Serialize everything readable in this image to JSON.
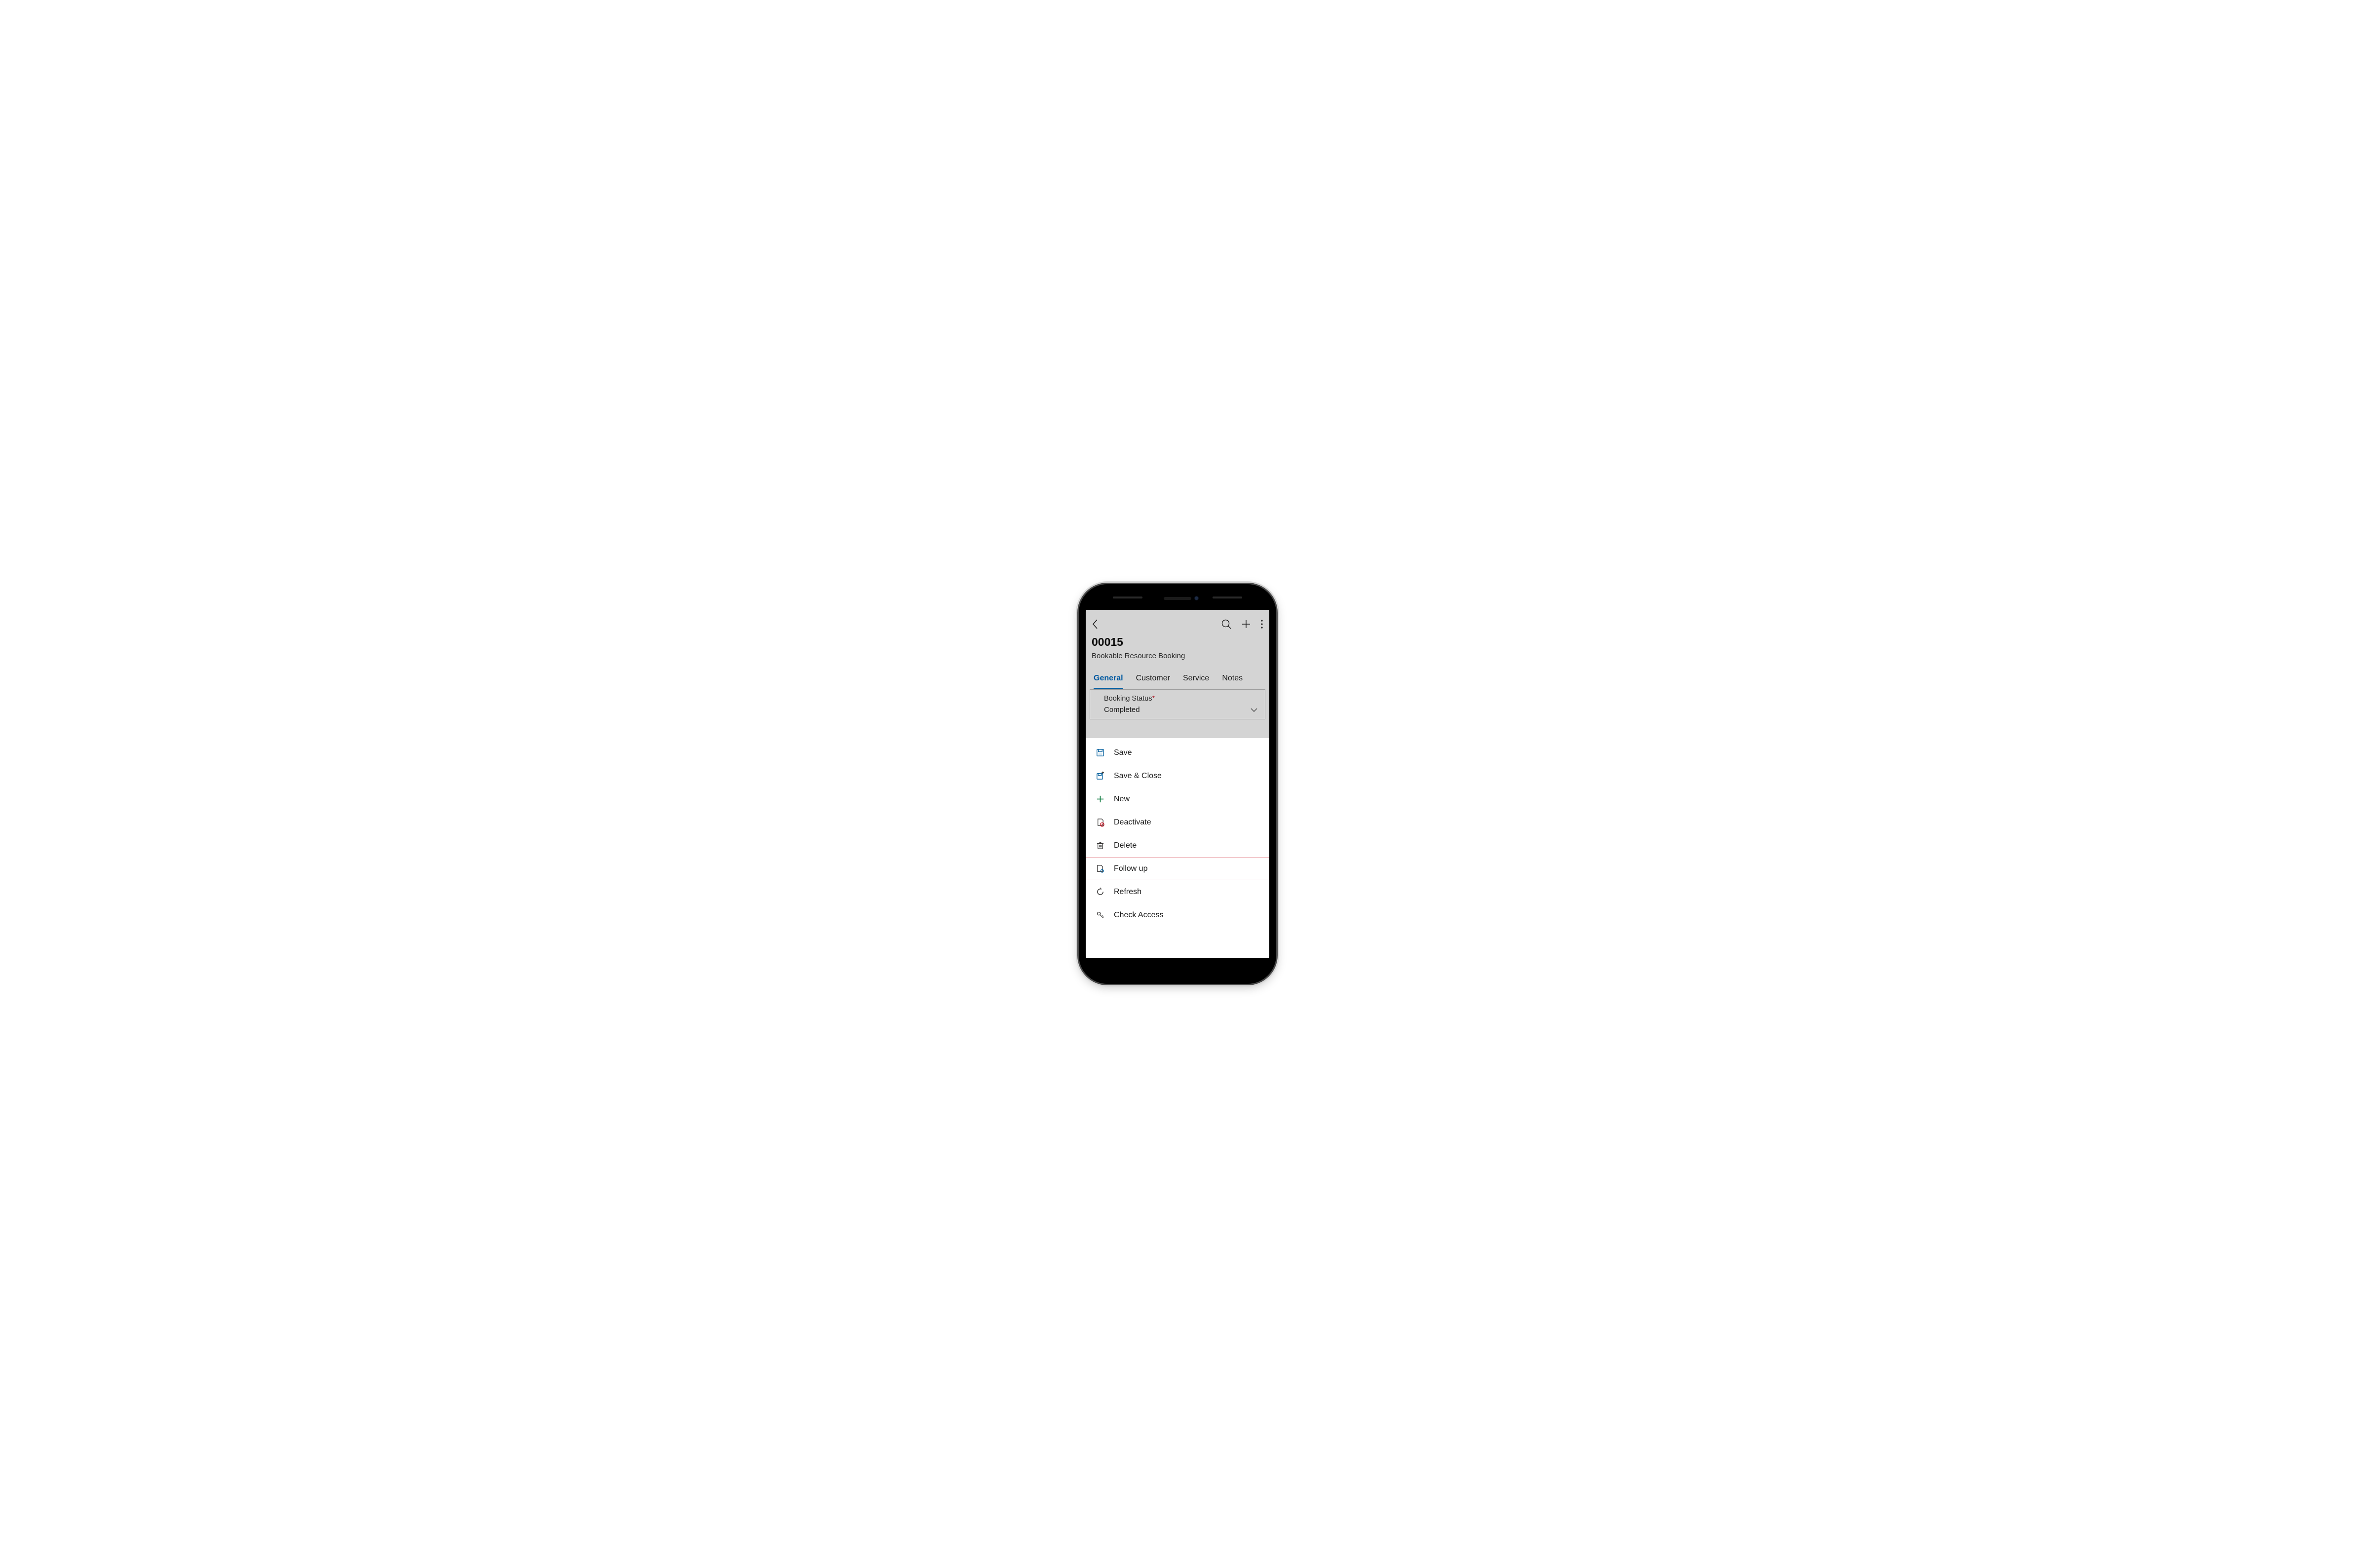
{
  "header": {
    "title": "00015",
    "subtitle": "Bookable Resource Booking"
  },
  "tabs": [
    {
      "label": "General",
      "active": true
    },
    {
      "label": "Customer",
      "active": false
    },
    {
      "label": "Service",
      "active": false
    },
    {
      "label": "Notes",
      "active": false
    }
  ],
  "form": {
    "booking_status": {
      "label": "Booking Status",
      "required": true,
      "value": "Completed"
    }
  },
  "menu": [
    {
      "icon": "save",
      "label": "Save"
    },
    {
      "icon": "save-close",
      "label": "Save & Close"
    },
    {
      "icon": "new",
      "label": "New"
    },
    {
      "icon": "deactivate",
      "label": "Deactivate"
    },
    {
      "icon": "delete",
      "label": "Delete"
    },
    {
      "icon": "followup",
      "label": "Follow up",
      "highlight": true
    },
    {
      "icon": "refresh",
      "label": "Refresh"
    },
    {
      "icon": "check-access",
      "label": "Check Access"
    }
  ],
  "highlight_color": "#e89aa0"
}
